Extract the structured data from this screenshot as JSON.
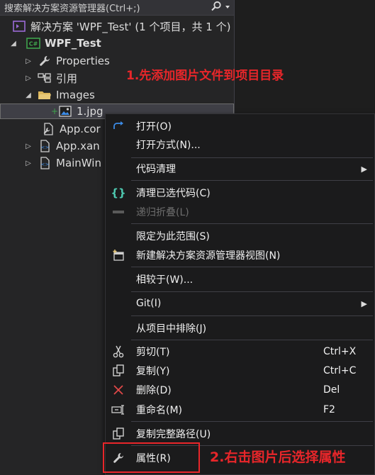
{
  "search": {
    "placeholder": "搜索解决方案资源管理器(Ctrl+;)"
  },
  "tree": {
    "solution": "解决方案 'WPF_Test' (1 个项目，共 1 个)",
    "project": "WPF_Test",
    "items": {
      "properties": "Properties",
      "references": "引用",
      "images": "Images",
      "image_file": "1.jpg",
      "app_config": "App.cor",
      "app_xaml": "App.xan",
      "main_window": "MainWin"
    }
  },
  "annotations": {
    "step1": "1.先添加图片文件到项目目录",
    "step2": "2.右击图片后选择属性"
  },
  "menu": {
    "open": "打开(O)",
    "open_with": "打开方式(N)...",
    "code_cleanup": "代码清理",
    "clean_selected": "清理已选代码(C)",
    "recursive_collapse": "递归折叠(L)",
    "scope_to_this": "限定为此范围(S)",
    "new_view": "新建解决方案资源管理器视图(N)",
    "compare_with": "相较于(W)...",
    "git": "Git(I)",
    "exclude": "从项目中排除(J)",
    "cut": "剪切(T)",
    "cut_shortcut": "Ctrl+X",
    "copy": "复制(Y)",
    "copy_shortcut": "Ctrl+C",
    "delete": "删除(D)",
    "delete_shortcut": "Del",
    "rename": "重命名(M)",
    "rename_shortcut": "F2",
    "copy_full_path": "复制完整路径(U)",
    "properties": "属性(R)"
  },
  "colors": {
    "annotation": "#e8262a",
    "accent_blue": "#3c8ce7",
    "project_green": "#3fa34d",
    "delete_red": "#e04848",
    "folder_yellow": "#dcb65a"
  }
}
